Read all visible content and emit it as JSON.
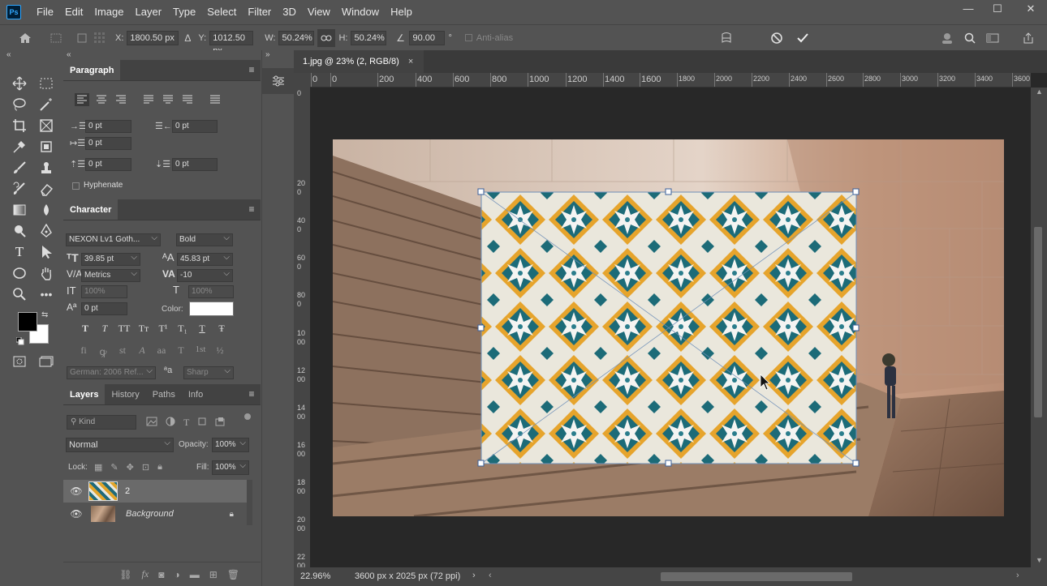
{
  "app": {
    "logo": "Ps"
  },
  "menu": [
    "File",
    "Edit",
    "Image",
    "Layer",
    "Type",
    "Select",
    "Filter",
    "3D",
    "View",
    "Window",
    "Help"
  ],
  "window_controls": {
    "minimize": "—",
    "maximize": "☐",
    "close": "✕"
  },
  "options": {
    "x_label": "X:",
    "x_value": "1800.50 px",
    "y_label": "Y:",
    "y_value": "1012.50 px",
    "w_label": "W:",
    "w_value": "50.24%",
    "h_label": "H:",
    "h_value": "50.24%",
    "angle_value": "90.00",
    "angle_unit": "°",
    "antialias_label": "Anti-alias"
  },
  "paragraph": {
    "tab": "Paragraph",
    "indent_left": "0 pt",
    "indent_right": "0 pt",
    "indent_first": "0 pt",
    "space_before": "0 pt",
    "space_after": "0 pt",
    "hyphenate": "Hyphenate"
  },
  "character": {
    "tab": "Character",
    "font_family": "NEXON Lv1 Goth...",
    "font_style": "Bold",
    "size": "39.85 pt",
    "leading": "45.83 pt",
    "kerning": "Metrics",
    "tracking": "-10",
    "vscale": "100%",
    "hscale": "100%",
    "baseline": "0 pt",
    "color_label": "Color:",
    "language": "German: 2006 Ref...",
    "antialias": "Sharp",
    "type_buttons": [
      "T",
      "T",
      "TT",
      "Tт",
      "T¹",
      "T₁",
      "T",
      "Ŧ"
    ],
    "opentype_buttons": [
      "fi",
      "ꝙ",
      "st",
      "A",
      "aa",
      "T",
      "1st",
      "½"
    ]
  },
  "layers": {
    "tabs": [
      "Layers",
      "History",
      "Paths",
      "Info"
    ],
    "kind": "Kind",
    "blend": "Normal",
    "opacity_label": "Opacity:",
    "opacity": "100%",
    "lock_label": "Lock:",
    "fill_label": "Fill:",
    "fill": "100%",
    "items": [
      {
        "name": "2"
      },
      {
        "name": "Background"
      }
    ]
  },
  "document": {
    "tab": "1.jpg @ 23% (2, RGB/8)",
    "close": "×",
    "zoom": "22.96%",
    "dims": "3600 px x 2025 px (72 ppi)"
  },
  "ruler_h": [
    "0",
    "0",
    "200",
    "400",
    "600",
    "800",
    "1000",
    "1200",
    "1400",
    "1600",
    "1800",
    "2000",
    "2200",
    "2400",
    "2600",
    "2800",
    "3000",
    "3200",
    "3400",
    "3600"
  ],
  "ruler_v": [
    "0",
    "200",
    "400",
    "600",
    "800",
    "1000",
    "1200",
    "1400",
    "1600",
    "1800",
    "2000",
    "2200"
  ]
}
